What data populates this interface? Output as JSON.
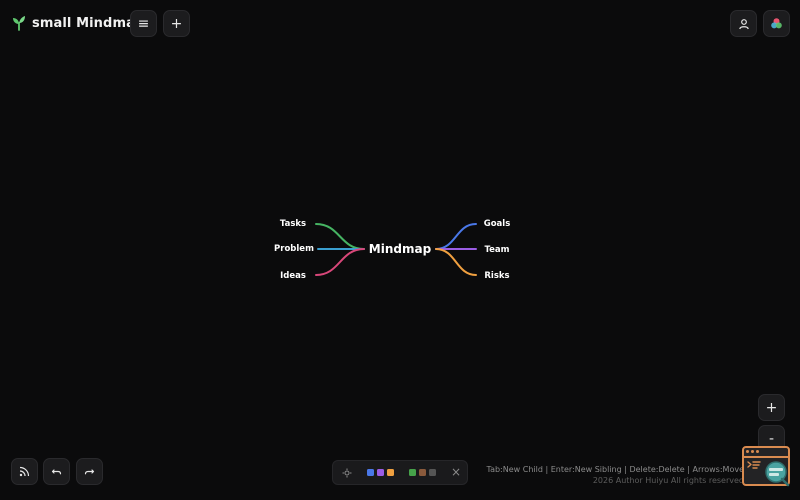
{
  "app": {
    "title": "small Mindmap",
    "logo_icon": "leaf-sprout-icon",
    "accent_green": "#5fc76e"
  },
  "header": {
    "menu_icon": "≡",
    "add_icon": "+",
    "user_icon": "user-icon",
    "theme_icon": "color-circles-icon"
  },
  "mindmap": {
    "root": {
      "label": "Mindmap"
    },
    "left_branches": [
      {
        "label": "Tasks",
        "color": "#46b463"
      },
      {
        "label": "Problem",
        "color": "#3a9fd0"
      },
      {
        "label": "Ideas",
        "color": "#d9477a"
      }
    ],
    "right_branches": [
      {
        "label": "Goals",
        "color": "#4a78e8"
      },
      {
        "label": "Team",
        "color": "#9b5de5"
      },
      {
        "label": "Risks",
        "color": "#f0a040"
      }
    ]
  },
  "zoom": {
    "in_label": "+",
    "out_label": "-"
  },
  "bottom_left": {
    "rss_icon": "rss-icon",
    "undo_icon": "undo-icon",
    "redo_icon": "redo-icon"
  },
  "palette": {
    "settings_icon": "gear-icon",
    "close_label": "×",
    "swatches_a": [
      "#4a78e8",
      "#9b5de5",
      "#f0a040"
    ],
    "swatches_b": [
      "#46a24a",
      "#8a5a3c",
      "#555555"
    ]
  },
  "footer": {
    "shortcuts": "Tab:New Child | Enter:New Sibling | Delete:Delete | Arrows:Move",
    "copyright": "2026 Author Huiyu All rights reserved"
  }
}
